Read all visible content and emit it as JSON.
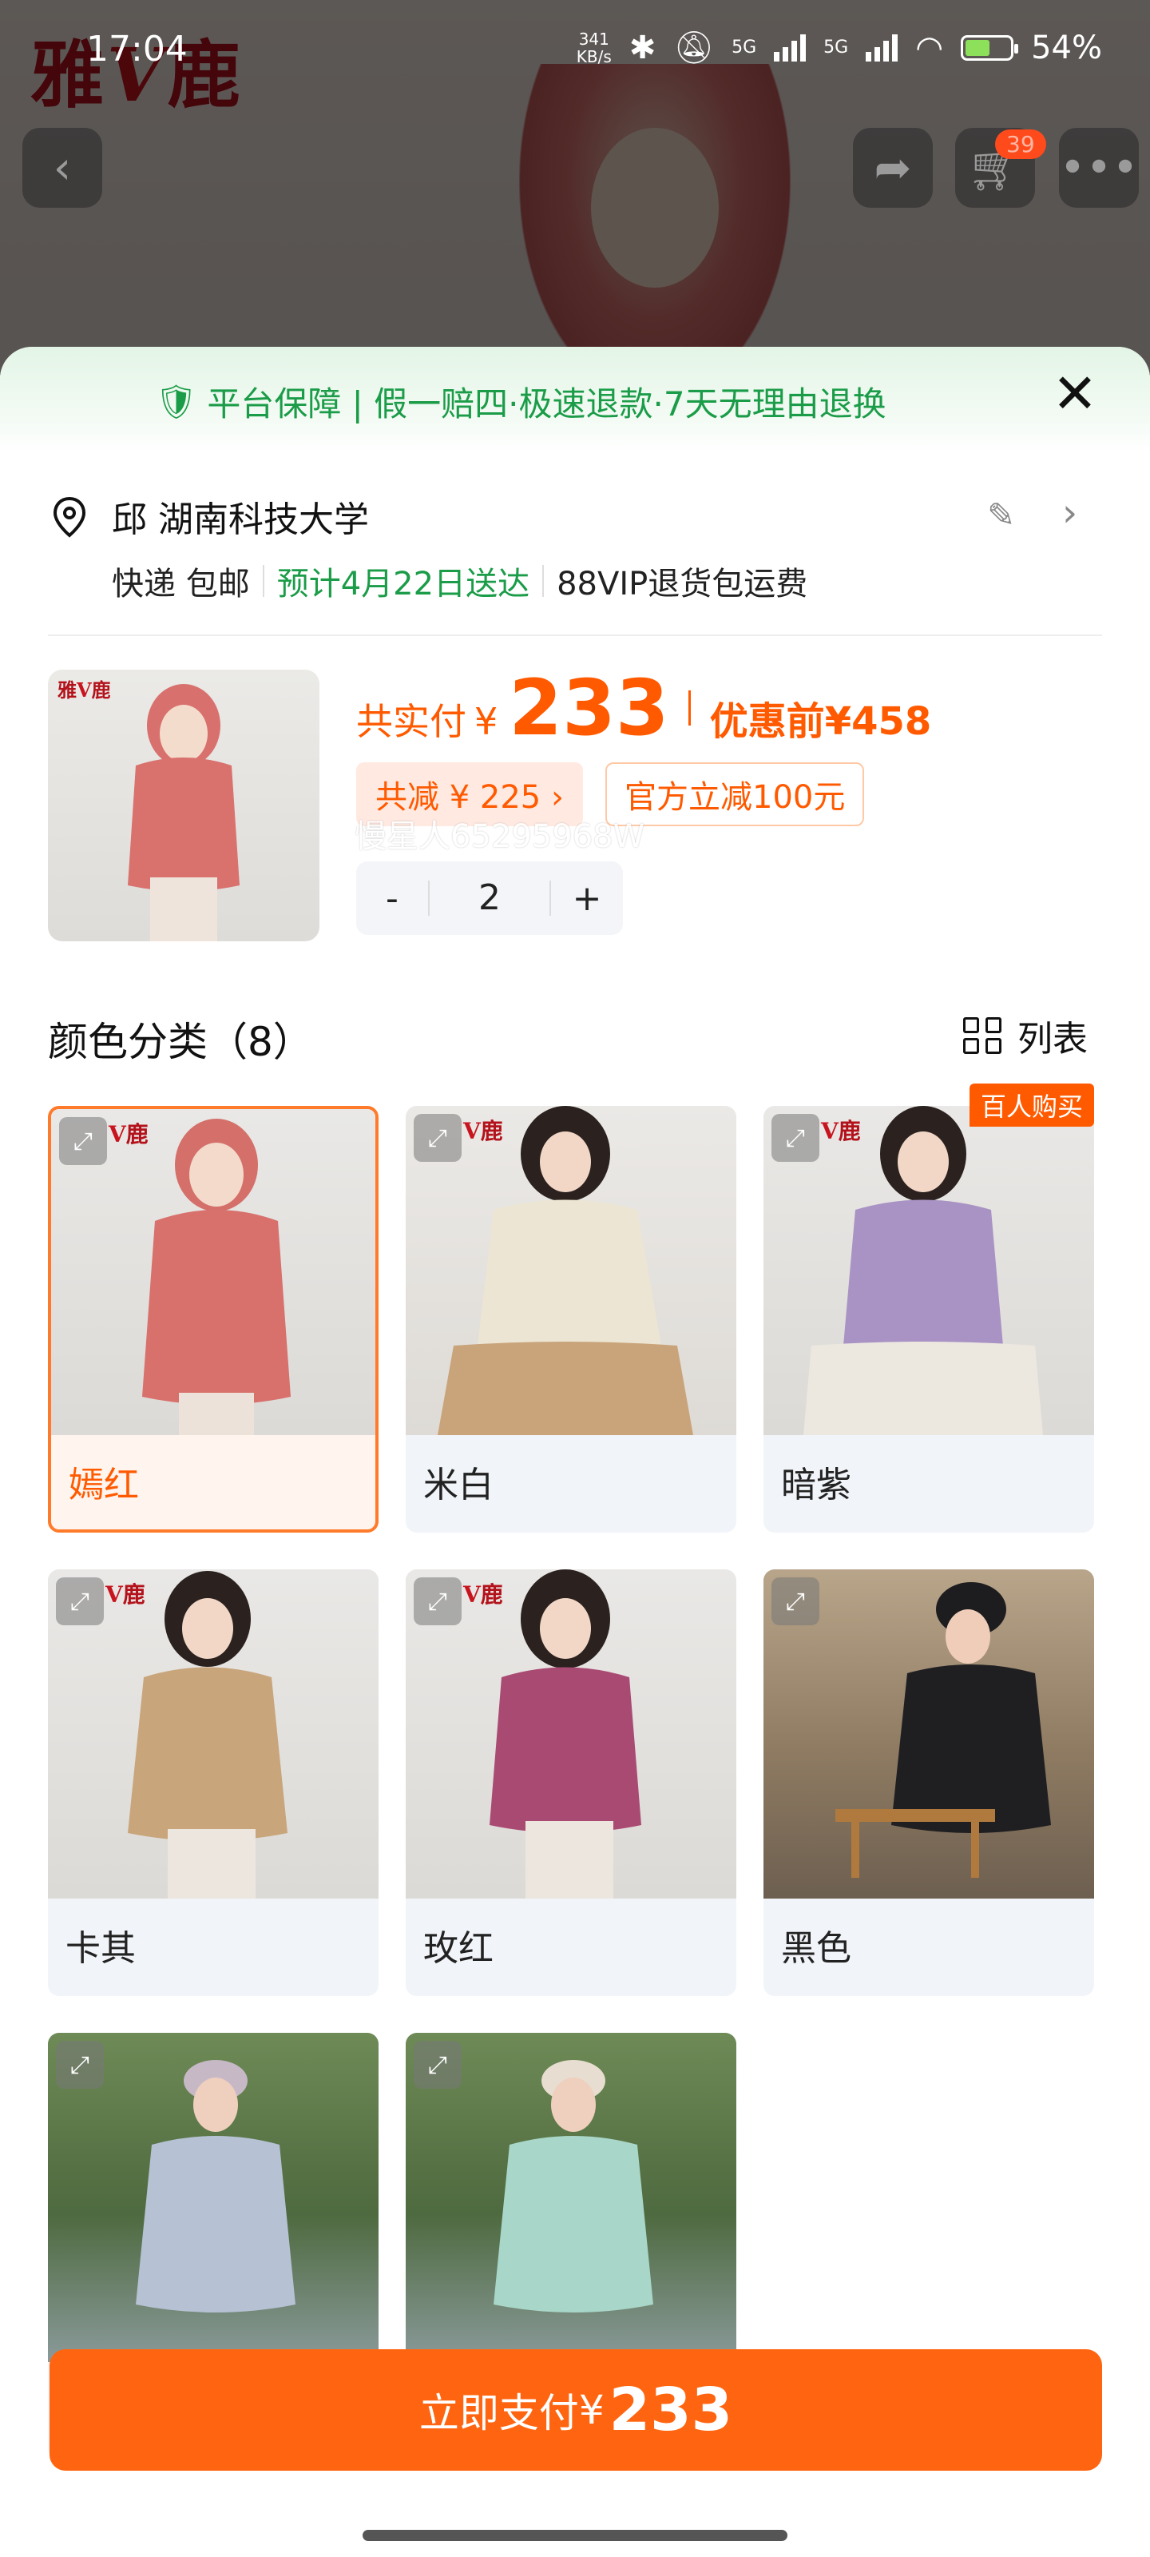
{
  "status_bar": {
    "time": "17:04",
    "speed_value": "341",
    "speed_unit": "KB/s",
    "net1": "5G",
    "net2": "5G",
    "battery": "54%"
  },
  "background": {
    "brand_logo_left": "雅",
    "brand_logo_right": "鹿",
    "cart_count": "39"
  },
  "sheet": {
    "guarantee_text": "平台保障 | 假一赔四·极速退款·7天无理由退换",
    "address": {
      "name": "邱 湖南科技大学",
      "shipping_method": "快递 包邮",
      "delivery_estimate": "预计4月22日送达",
      "return_policy": "88VIP退货包运费"
    },
    "price": {
      "pay_label": "共实付",
      "currency": "¥",
      "pay_amount": "233",
      "before_label": "优惠前",
      "before_amount": "¥458",
      "discount_text": "共减 ¥ 225 ›",
      "official_discount": "官方立减100元"
    },
    "quantity": {
      "minus": "-",
      "value": "2",
      "plus": "+"
    },
    "color_section": {
      "title": "颜色分类（8）",
      "view_label": "列表"
    },
    "watermark": "慢星人65295968W",
    "options": [
      {
        "label": "嫣红",
        "selected": true,
        "badge": ""
      },
      {
        "label": "米白",
        "selected": false,
        "badge": ""
      },
      {
        "label": "暗紫",
        "selected": false,
        "badge": "百人购买"
      },
      {
        "label": "卡其",
        "selected": false,
        "badge": ""
      },
      {
        "label": "玫红",
        "selected": false,
        "badge": ""
      },
      {
        "label": "黑色",
        "selected": false,
        "badge": ""
      },
      {
        "label": "",
        "selected": false,
        "badge": ""
      },
      {
        "label": "",
        "selected": false,
        "badge": ""
      }
    ],
    "pay_button": {
      "label": "立即支付",
      "currency": "¥",
      "amount": "233"
    }
  },
  "colors": {
    "accent": "#ff5a00",
    "button": "#ff6510",
    "green": "#1b9c48",
    "brand_red": "#b3121b"
  },
  "icons": [
    "back-arrow-icon",
    "share-icon",
    "cart-icon",
    "more-icon",
    "shield-check-icon",
    "close-icon",
    "location-pin-icon",
    "edit-pencil-icon",
    "chevron-right-icon",
    "grid-list-icon",
    "zoom-expand-icon"
  ]
}
